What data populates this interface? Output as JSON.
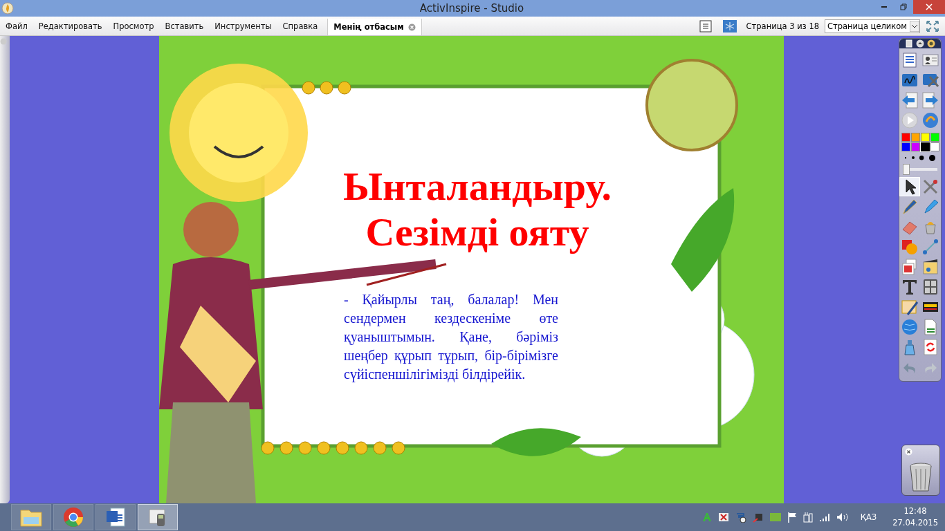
{
  "window": {
    "title": "ActivInspire - Studio"
  },
  "menu": [
    "Файл",
    "Редактировать",
    "Просмотр",
    "Вставить",
    "Инструменты",
    "Справка"
  ],
  "document_tab": {
    "label": "Менің отбасым"
  },
  "page_indicator": "Страница 3 из 18",
  "zoom_select": {
    "value": "Страница целиком"
  },
  "slide": {
    "title_lines": [
      "Ынталандыру.",
      "Сезімді ояту"
    ],
    "body": "-  Қайырлы таң, балалар! Мен сендермен кездескеніме өте қуаныштымын. Қане,  бәріміз шеңбер құрып тұрып, бір-бірімізге сүйіспеншілігімізді білдірейік."
  },
  "toolbox": {
    "tools_top": [
      {
        "kind": "menu",
        "selected": false
      },
      {
        "kind": "profile",
        "selected": false
      },
      {
        "kind": "tablet",
        "selected": false
      },
      {
        "kind": "designer",
        "selected": false
      },
      {
        "kind": "prev",
        "selected": false
      },
      {
        "kind": "next",
        "selected": false
      },
      {
        "kind": "play",
        "selected": false
      },
      {
        "kind": "resource",
        "selected": false
      }
    ],
    "colors": [
      {
        "color": "#ff0000",
        "selected": false
      },
      {
        "color": "#ffa500",
        "selected": false
      },
      {
        "color": "#ffff00",
        "selected": false
      },
      {
        "color": "#00ff00",
        "selected": false
      },
      {
        "color": "#0000ff",
        "selected": false
      },
      {
        "color": "#cc00ff",
        "selected": false
      },
      {
        "color": "#000000",
        "selected": true
      },
      {
        "color": "#ffffff",
        "selected": false
      }
    ],
    "widths": [
      {
        "selected": false
      },
      {
        "selected": false
      },
      {
        "selected": false
      },
      {
        "selected": false
      }
    ],
    "pen_width": {
      "level": 0
    },
    "tools": [
      {
        "kind": "select",
        "selected": true
      },
      {
        "kind": "magic",
        "selected": false
      },
      {
        "kind": "pen",
        "selected": false
      },
      {
        "kind": "highlighter",
        "selected": false
      },
      {
        "kind": "eraser",
        "selected": false
      },
      {
        "kind": "fill",
        "selected": false
      },
      {
        "kind": "shapes",
        "selected": false
      },
      {
        "kind": "connector",
        "selected": false
      },
      {
        "kind": "images",
        "selected": false
      },
      {
        "kind": "media",
        "selected": false
      },
      {
        "kind": "text",
        "selected": false
      },
      {
        "kind": "keypad",
        "selected": false
      },
      {
        "kind": "handwriting",
        "selected": false
      },
      {
        "kind": "ticker",
        "selected": false
      },
      {
        "kind": "web",
        "selected": false
      },
      {
        "kind": "spell",
        "selected": false
      },
      {
        "kind": "clear",
        "selected": false
      },
      {
        "kind": "reset",
        "selected": false
      },
      {
        "kind": "undo",
        "selected": false
      },
      {
        "kind": "redo",
        "selected": false
      }
    ]
  },
  "taskbar": {
    "apps": [
      {
        "kind": "folder",
        "selected": false
      },
      {
        "kind": "chrome",
        "selected": false
      },
      {
        "kind": "word",
        "selected": false
      },
      {
        "kind": "inspire",
        "selected": true
      }
    ],
    "language": "ҚАЗ",
    "time": "12:48",
    "date": "27.04.2015"
  }
}
